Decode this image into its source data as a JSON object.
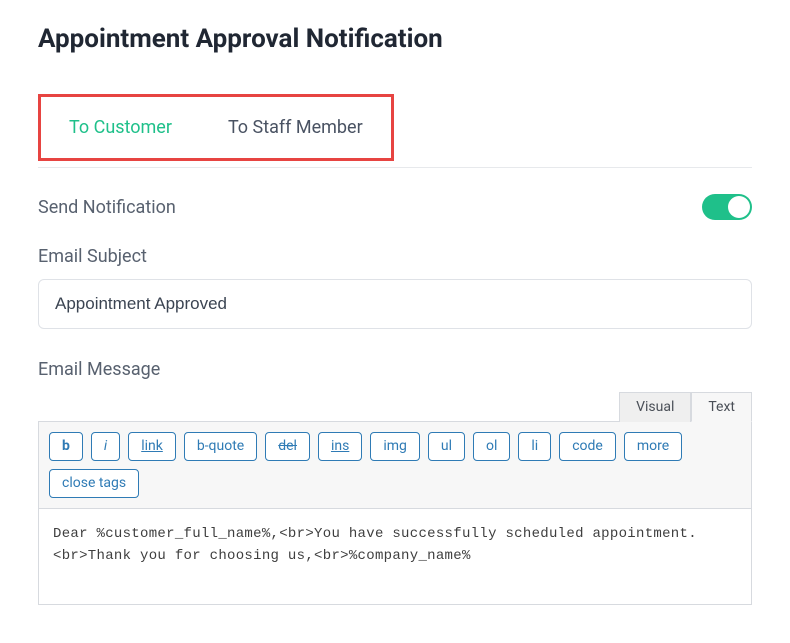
{
  "page_title": "Appointment Approval Notification",
  "tabs": {
    "to_customer": "To Customer",
    "to_staff": "To Staff Member",
    "active": "to_customer"
  },
  "send_notification": {
    "label": "Send Notification",
    "value": true
  },
  "email_subject": {
    "label": "Email Subject",
    "value": "Appointment Approved"
  },
  "email_message": {
    "label": "Email Message",
    "editor_tabs": {
      "visual": "Visual",
      "text": "Text",
      "active": "text"
    },
    "quicktags": {
      "b": "b",
      "i": "i",
      "link": "link",
      "bquote": "b-quote",
      "del": "del",
      "ins": "ins",
      "img": "img",
      "ul": "ul",
      "ol": "ol",
      "li": "li",
      "code": "code",
      "more": "more",
      "close": "close tags"
    },
    "content": "Dear %customer_full_name%,<br>You have successfully scheduled appointment.<br>Thank you for choosing us,<br>%company_name%"
  }
}
